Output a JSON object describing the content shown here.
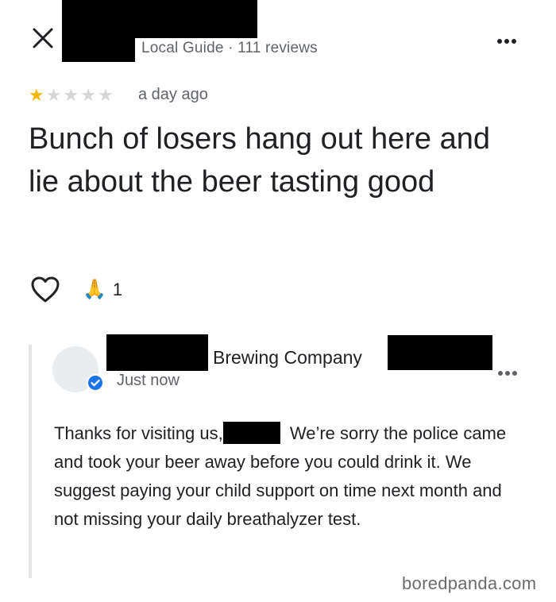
{
  "header": {
    "meta": "Local Guide · 111 reviews",
    "close_icon": "close-icon",
    "more_icon": "more-horizontal-icon"
  },
  "review": {
    "rating": 1,
    "max_rating": 5,
    "star_filled_color": "#f5b800",
    "star_empty_color": "#d6d6d6",
    "time": "a day ago",
    "text": "Bunch of losers hang out here and lie about the beer tasting good",
    "reaction_emoji": "🙏",
    "reaction_count": "1"
  },
  "reply": {
    "business_name": "Brewing Company",
    "time": "Just now",
    "text_before": "Thanks for visiting us,",
    "text_after": " We’re sorry the police came and took your beer away before you could drink it. We suggest paying your child support on time next month and not missing your daily breathalyzer test.",
    "verified_color": "#1a73e8"
  },
  "watermark": "boredpanda.com"
}
